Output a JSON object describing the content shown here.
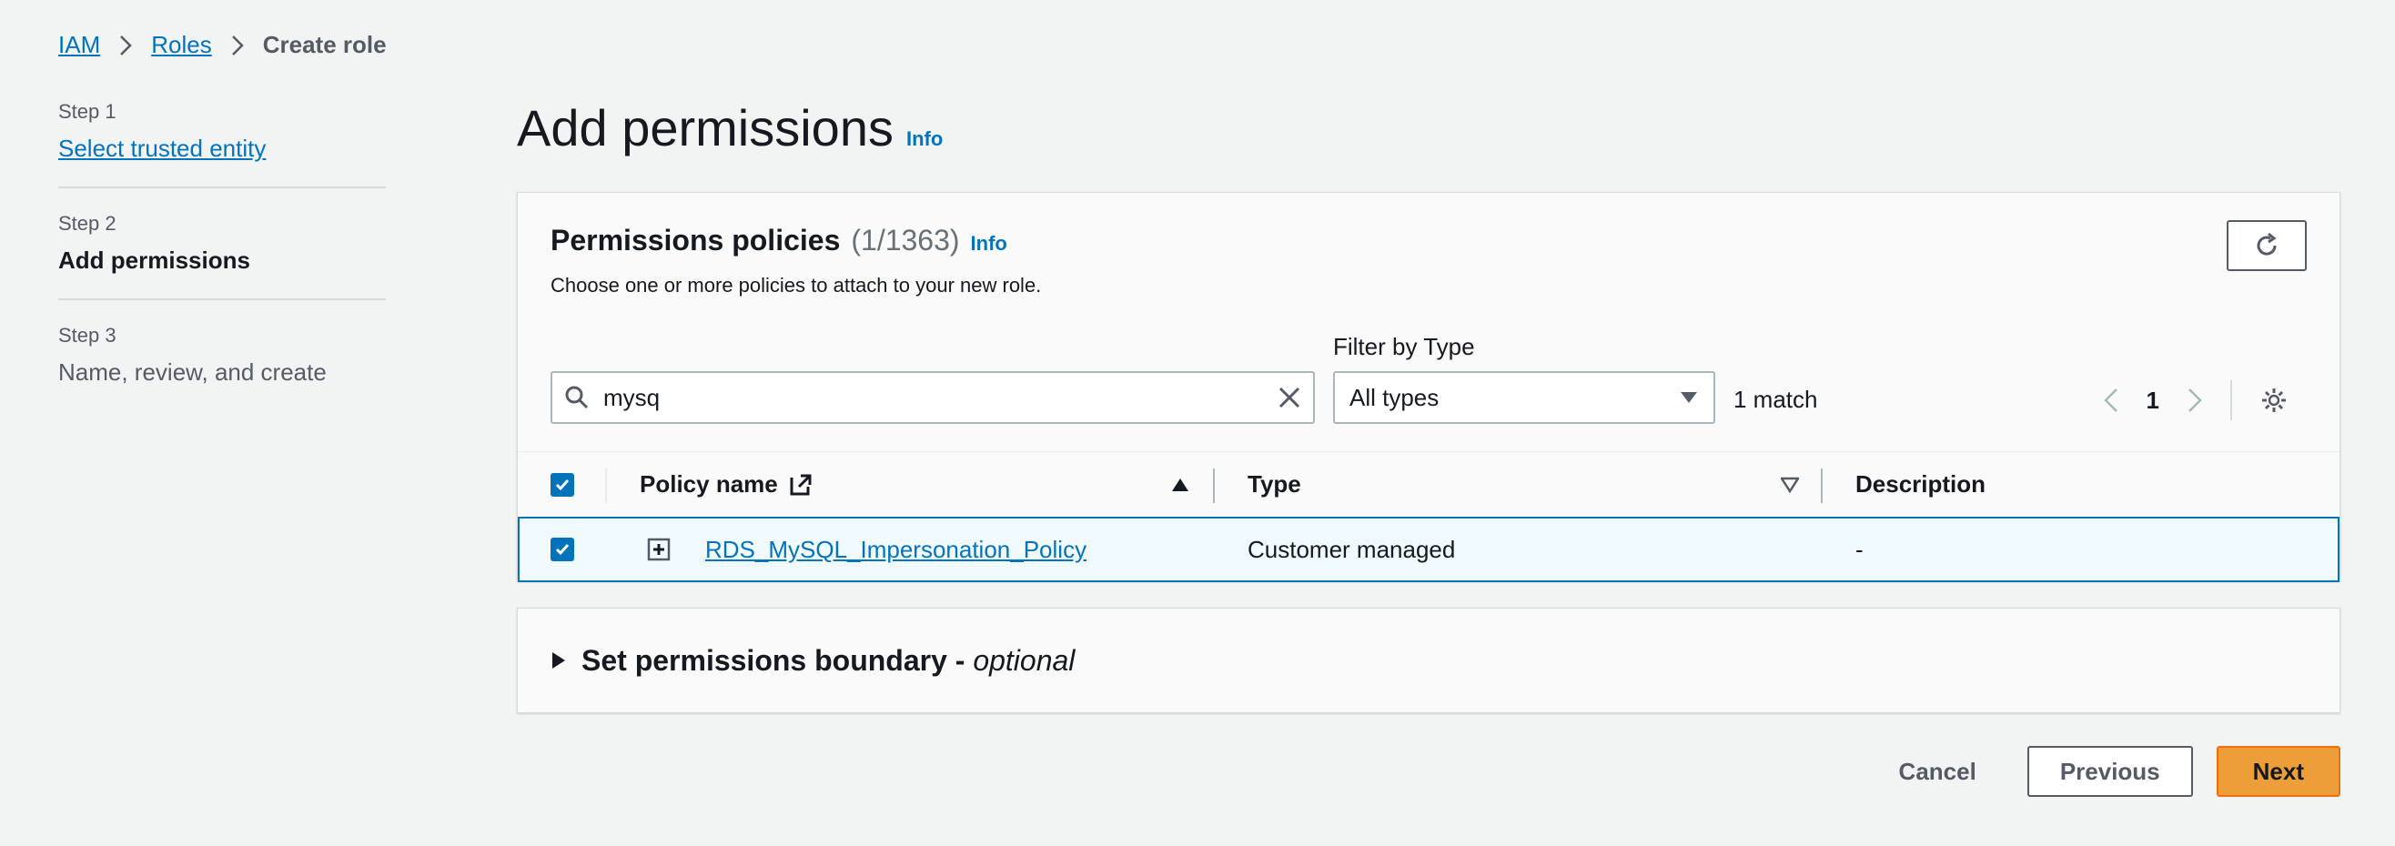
{
  "breadcrumb": {
    "items": [
      "IAM",
      "Roles",
      "Create role"
    ]
  },
  "steps": [
    {
      "num": "Step 1",
      "title": "Select trusted entity"
    },
    {
      "num": "Step 2",
      "title": "Add permissions"
    },
    {
      "num": "Step 3",
      "title": "Name, review, and create"
    }
  ],
  "page": {
    "title": "Add permissions",
    "info": "Info"
  },
  "policies": {
    "title": "Permissions policies",
    "count": "(1/1363)",
    "info": "Info",
    "description": "Choose one or more policies to attach to your new role.",
    "search_value": "mysq",
    "filter_label": "Filter by Type",
    "filter_value": "All types",
    "match_text": "1 match",
    "page_number": "1",
    "columns": {
      "policy_name": "Policy name",
      "type": "Type",
      "description": "Description"
    },
    "rows": [
      {
        "name": "RDS_MySQL_Impersonation_Policy",
        "type": "Customer managed",
        "description": "-"
      }
    ]
  },
  "boundary": {
    "title": "Set permissions boundary - ",
    "optional": "optional"
  },
  "actions": {
    "cancel": "Cancel",
    "previous": "Previous",
    "next": "Next"
  },
  "colors": {
    "link": "#0073bb",
    "primary": "#ec9f38",
    "selected_row": "#f1faff"
  }
}
